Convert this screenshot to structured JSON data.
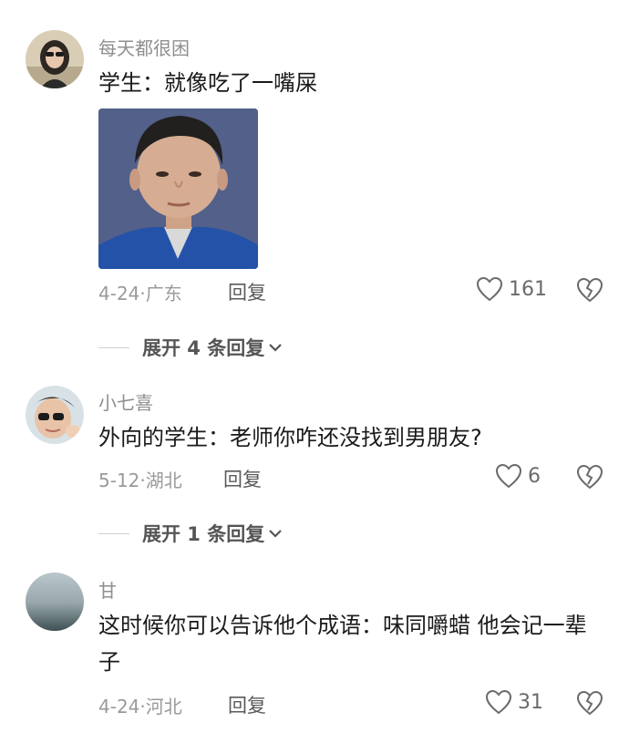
{
  "comments": [
    {
      "username": "每天都很困",
      "text": "学生：就像吃了一嘴屎",
      "date": "4-24·",
      "location": "广东",
      "reply_label": "回复",
      "likes": "161",
      "expand_label": "展开 4 条回复"
    },
    {
      "username": "小七喜",
      "text": "外向的学生：老师你咋还没找到男朋友?",
      "date": "5-12·",
      "location": "湖北",
      "reply_label": "回复",
      "likes": "6",
      "expand_label": "展开 1 条回复"
    },
    {
      "username": "甘",
      "text": "这时候你可以告诉他个成语：味同嚼蜡  他会记一辈子",
      "date": "4-24·",
      "location": "河北",
      "reply_label": "回复",
      "likes": "31"
    }
  ],
  "icons": {
    "like": "heart-outline-icon",
    "dislike": "broken-heart-icon",
    "expand": "chevron-down-icon"
  },
  "colors": {
    "text": "#1a1a1a",
    "meta": "#9a9a9a",
    "username": "#8f8f8f"
  }
}
